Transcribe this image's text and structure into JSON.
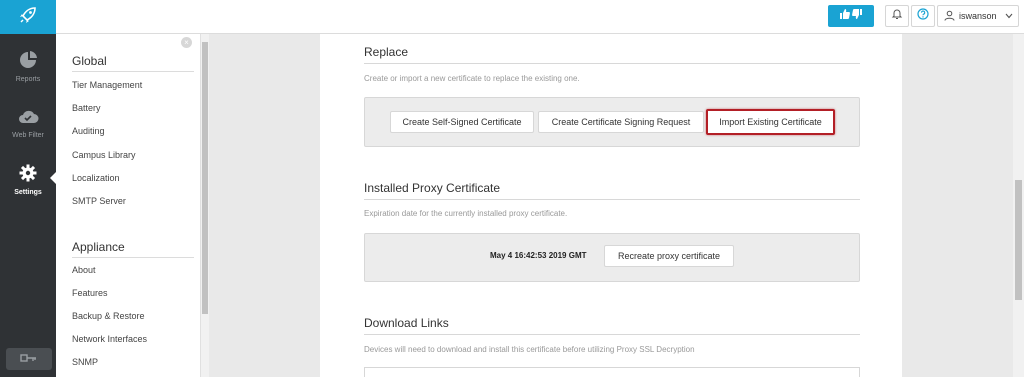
{
  "rail": {
    "items": [
      {
        "label": "Reports",
        "icon": "pie-chart-icon"
      },
      {
        "label": "Web Filter",
        "icon": "cloud-check-icon"
      },
      {
        "label": "Settings",
        "icon": "gear-icon",
        "active": true
      }
    ],
    "logo_icon": "rocket-icon",
    "bottom_icon": "key-icon"
  },
  "header": {
    "feedback_icon": "thumbs-up-down-icon",
    "notifications_icon": "bell-icon",
    "help_icon": "help-icon",
    "user": {
      "name": "iswanson",
      "icon": "user-icon",
      "caret_icon": "chevron-down-icon"
    }
  },
  "subnav": {
    "close_icon": "close-icon",
    "sections": [
      {
        "title": "Global",
        "items": [
          "Tier Management",
          "Battery",
          "Auditing",
          "Campus Library",
          "Localization",
          "SMTP Server"
        ]
      },
      {
        "title": "Appliance",
        "items": [
          "About",
          "Features",
          "Backup & Restore",
          "Network Interfaces",
          "SNMP"
        ]
      }
    ]
  },
  "main": {
    "replace": {
      "title": "Replace",
      "description": "Create or import a new certificate to replace the existing one.",
      "buttons": [
        "Create Self-Signed Certificate",
        "Create Certificate Signing Request",
        "Import Existing Certificate"
      ]
    },
    "installed": {
      "title": "Installed Proxy Certificate",
      "description": "Expiration date for the currently installed proxy certificate.",
      "expiry": "May 4 16:42:53 2019 GMT",
      "recreate_label": "Recreate proxy certificate"
    },
    "downloads": {
      "title": "Download Links",
      "description": "Devices will need to download and install this certificate before utilizing Proxy SSL Decryption"
    }
  },
  "colors": {
    "accent": "#1aa3d3",
    "highlight": "#b31f26",
    "rail": "#2f3235"
  }
}
